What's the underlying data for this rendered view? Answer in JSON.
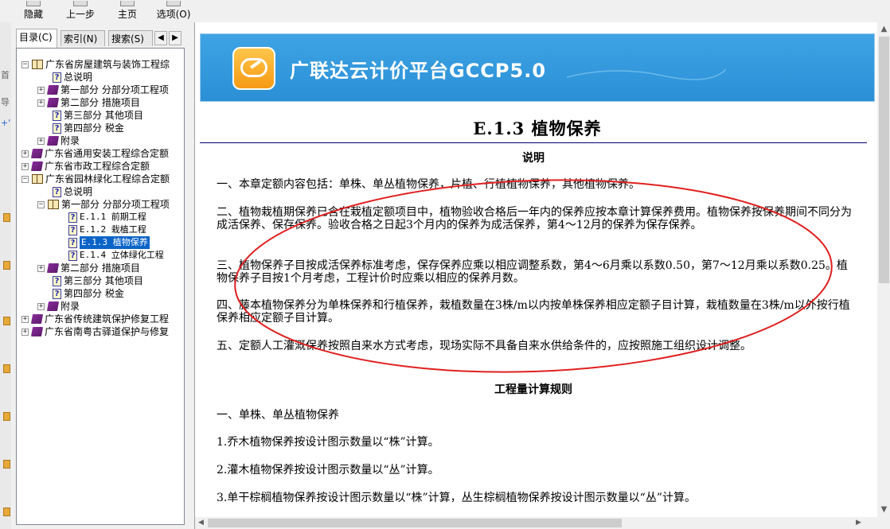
{
  "toolbar": {
    "hide_label": "隐藏",
    "back_label": "上一步",
    "home_label": "主页",
    "options_label": "选项(O)"
  },
  "left_strip": {
    "marks": [
      "首",
      "导",
      "+'"
    ]
  },
  "nav_tabs": [
    {
      "label": "目录(C)"
    },
    {
      "label": "索引(N)"
    },
    {
      "label": "搜索(S)"
    }
  ],
  "tree": [
    {
      "label": "广东省房屋建筑与装饰工程综"
    },
    {
      "label": "总说明"
    },
    {
      "label": "第一部分 分部分项工程项"
    },
    {
      "label": "第二部分 措施项目"
    },
    {
      "label": "第三部分 其他项目"
    },
    {
      "label": "第四部分 税金"
    },
    {
      "label": "附录"
    },
    {
      "label": "广东省通用安装工程综合定额"
    },
    {
      "label": "广东省市政工程综合定额"
    },
    {
      "label": "广东省园林绿化工程综合定额"
    },
    {
      "label": "总说明"
    },
    {
      "label": "第一部分 分部分项工程项"
    },
    {
      "label": "E.1.1 前期工程"
    },
    {
      "label": "E.1.2 栽植工程"
    },
    {
      "label": "E.1.3 植物保养"
    },
    {
      "label": "E.1.4 立体绿化工程"
    },
    {
      "label": "第二部分 措施项目"
    },
    {
      "label": "第三部分 其他项目"
    },
    {
      "label": "第四部分 税金"
    },
    {
      "label": "附录"
    },
    {
      "label": "广东省传统建筑保护修复工程"
    },
    {
      "label": "广东省南粤古驿道保护与修复"
    }
  ],
  "banner": {
    "title": "广联达云计价平台GCCP5.0"
  },
  "document": {
    "title": "E.1.3  植物保养",
    "heading_notes": "说明",
    "paras": [
      "一、本章定额内容包括：单株、单丛植物保养，片植、行植植物保养，其他植物保养。",
      "二、植物栽植期保养已含在栽植定额项目中，植物验收合格后一年内的保养应按本章计算保养费用。植物保养按保养期间不同分为成活保养、保存保养。验收合格之日起3个月内的保养为成活保养，第4～12月的保养为保存保养。",
      "三、植物保养子目按成活保养标准考虑，保存保养应乘以相应调整系数，第4～6月乘以系数0.50，第7～12月乘以系数0.25。植物保养子目按1个月考虑，工程计价时应乘以相应的保养月数。",
      "四、藤本植物保养分为单株保养和行植保养，栽植数量在3株/m以内按单株保养相应定额子目计算，栽植数量在3株/m以外按行植保养相应定额子目计算。",
      "五、定额人工灌溉保养按照自来水方式考虑，现场实际不具备自来水供给条件的，应按照施工组织设计调整。"
    ],
    "heading_rules": "工程量计算规则",
    "rules": [
      "一、单株、单丛植物保养",
      "1.乔木植物保养按设计图示数量以“株”计算。",
      "2.灌木植物保养按设计图示数量以“丛”计算。",
      "3.单干棕榈植物保养按设计图示数量以“株”计算，丛生棕榈植物保养按设计图示数量以“丛”计算。"
    ]
  },
  "colors": {
    "banner_blue": "#2b8fd6",
    "selection_blue": "#0a64c8",
    "annotation_red": "#e02020",
    "title_rule": "#00007a"
  }
}
